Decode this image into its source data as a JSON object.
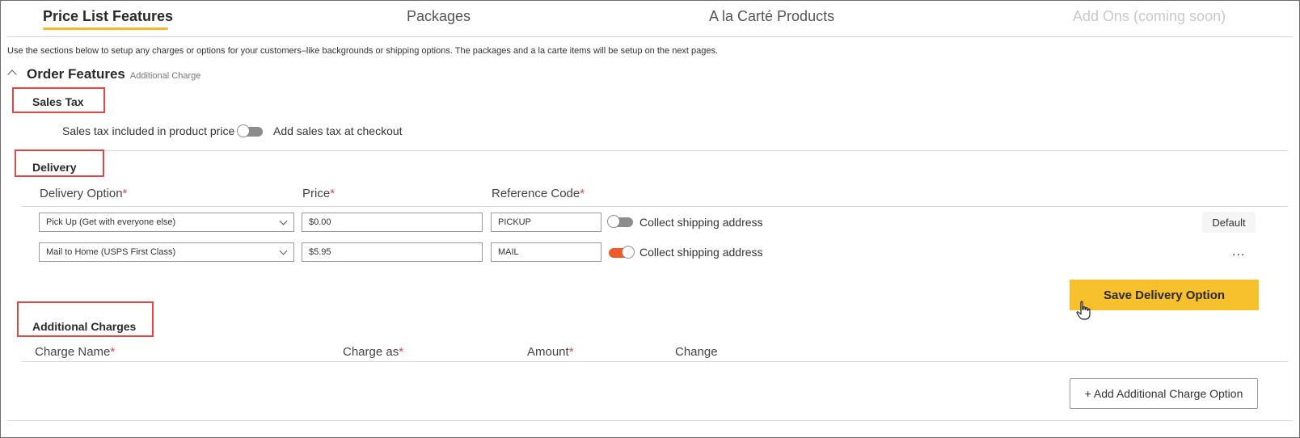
{
  "tabs": [
    {
      "label": "Price List Features",
      "state": "active"
    },
    {
      "label": "Packages",
      "state": "normal"
    },
    {
      "label": "A la Carté Products",
      "state": "normal"
    },
    {
      "label": "Add Ons (coming soon)",
      "state": "disabled"
    }
  ],
  "intro": "Use the sections below to setup any charges or options for your customers–like backgrounds or shipping options. The packages and a la carte items will be setup on the next pages.",
  "order_features": {
    "title": "Order Features",
    "subtitle": "Additional Charge"
  },
  "sales_tax": {
    "title": "Sales Tax",
    "left_label": "Sales tax included in product price",
    "right_label": "Add sales tax at checkout",
    "toggle_on": false
  },
  "delivery": {
    "title": "Delivery",
    "columns": {
      "option": "Delivery Option",
      "price": "Price",
      "reference": "Reference Code",
      "required_mark": "*"
    },
    "rows": [
      {
        "option": "Pick Up (Get with everyone else)",
        "price": "$0.00",
        "reference": "PICKUP",
        "collect_label": "Collect shipping address",
        "collect_on": false,
        "action": "Default"
      },
      {
        "option": "Mail to Home (USPS First Class)",
        "price": "$5.95",
        "reference": "MAIL",
        "collect_label": "Collect shipping address",
        "collect_on": true,
        "action": "..."
      }
    ],
    "save_label": "Save Delivery Option"
  },
  "additional_charges": {
    "title": "Additional Charges",
    "columns": {
      "name": "Charge Name",
      "charge_as": "Charge as",
      "amount": "Amount",
      "change": "Change",
      "required_mark": "*"
    },
    "add_label": "+ Add Additional Charge Option"
  },
  "colors": {
    "accent": "#f7c12e",
    "toggle_on": "#f05a28",
    "highlight_box": "#e04646"
  }
}
